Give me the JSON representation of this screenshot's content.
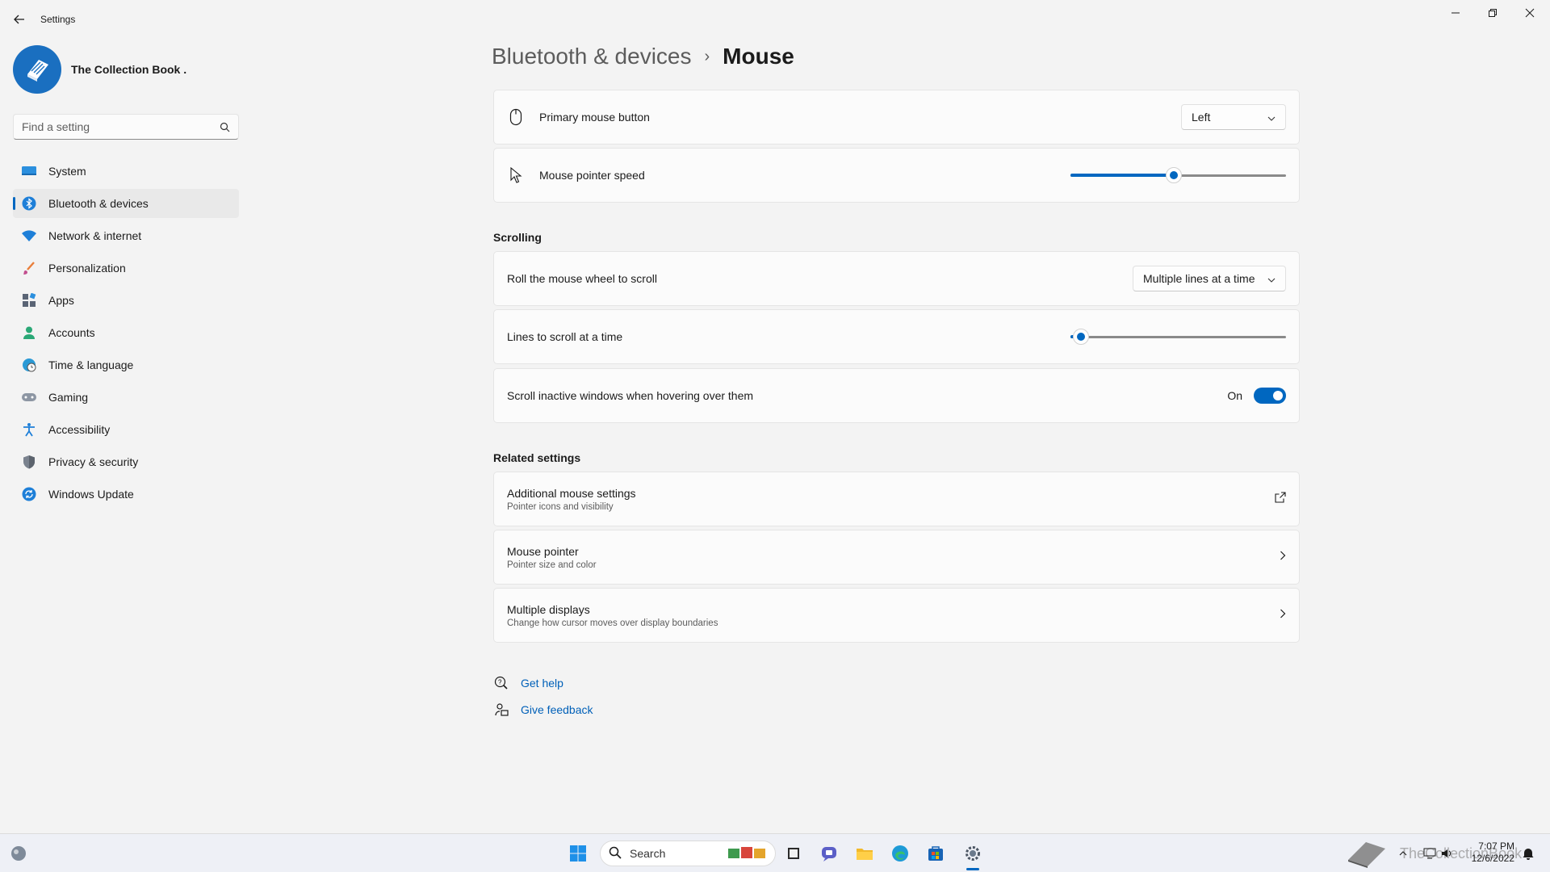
{
  "window": {
    "title": "Settings"
  },
  "profile": {
    "name": "The Collection Book ."
  },
  "search": {
    "placeholder": "Find a setting"
  },
  "nav": {
    "items": [
      {
        "label": "System",
        "icon": "system-icon"
      },
      {
        "label": "Bluetooth & devices",
        "icon": "bluetooth-icon",
        "active": true
      },
      {
        "label": "Network & internet",
        "icon": "wifi-icon"
      },
      {
        "label": "Personalization",
        "icon": "brush-icon"
      },
      {
        "label": "Apps",
        "icon": "apps-icon"
      },
      {
        "label": "Accounts",
        "icon": "person-icon"
      },
      {
        "label": "Time & language",
        "icon": "globe-clock-icon"
      },
      {
        "label": "Gaming",
        "icon": "gamepad-icon"
      },
      {
        "label": "Accessibility",
        "icon": "accessibility-icon"
      },
      {
        "label": "Privacy & security",
        "icon": "shield-icon"
      },
      {
        "label": "Windows Update",
        "icon": "update-icon"
      }
    ]
  },
  "breadcrumb": {
    "parent": "Bluetooth & devices",
    "separator": "›",
    "current": "Mouse"
  },
  "settings": {
    "primary_button": {
      "label": "Primary mouse button",
      "value": "Left"
    },
    "pointer_speed": {
      "label": "Mouse pointer speed",
      "level": 0.48
    },
    "scrolling_title": "Scrolling",
    "roll_wheel": {
      "label": "Roll the mouse wheel to scroll",
      "value": "Multiple lines at a time"
    },
    "lines_to_scroll": {
      "label": "Lines to scroll at a time",
      "level": 0.05
    },
    "scroll_inactive": {
      "label": "Scroll inactive windows when hovering over them",
      "state": "On"
    },
    "related_title": "Related settings",
    "additional": {
      "label": "Additional mouse settings",
      "sub": "Pointer icons and visibility"
    },
    "pointer": {
      "label": "Mouse pointer",
      "sub": "Pointer size and color"
    },
    "displays": {
      "label": "Multiple displays",
      "sub": "Change how cursor moves over display boundaries"
    }
  },
  "help": {
    "get_help": "Get help",
    "feedback": "Give feedback"
  },
  "taskbar": {
    "search_label": "Search",
    "time": "7:07 PM",
    "date": "12/6/2022",
    "watermark": "TheCollectionBook"
  },
  "colors": {
    "accent": "#0067c0",
    "background": "#f3f3f3",
    "card": "#fbfbfb"
  }
}
